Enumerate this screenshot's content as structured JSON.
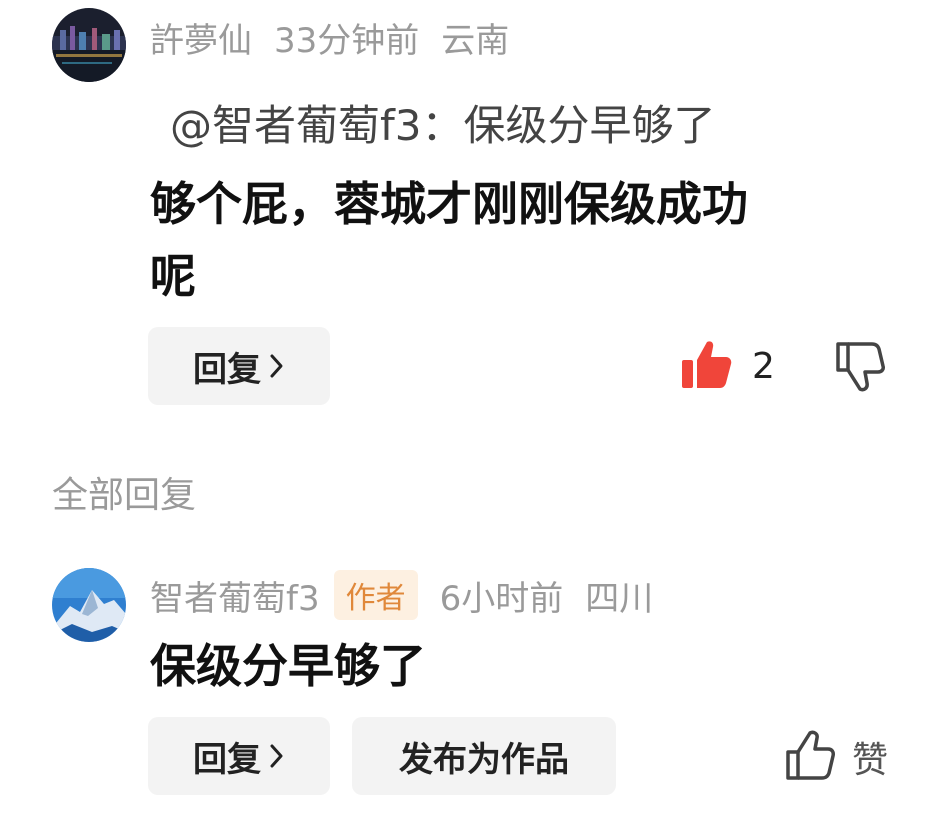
{
  "comment": {
    "username": "許夢仙",
    "time": "33分钟前",
    "location": "云南",
    "quote": "@智者葡萄f3：保级分早够了",
    "text_line1": "够个屁，蓉城才刚刚保级成功",
    "text_line2": "呢",
    "reply_label": "回复",
    "like_count": "2",
    "like_state": "liked",
    "accent_color": "#f0453a"
  },
  "replies_section": {
    "title": "全部回复"
  },
  "reply": {
    "username": "智者葡萄f3",
    "badge": "作者",
    "time": "6小时前",
    "location": "四川",
    "text": "保级分早够了",
    "reply_label": "回复",
    "publish_label": "发布为作品",
    "like_label": "赞"
  },
  "icons": {
    "thumbs_up_filled": "thumbs-up-filled-icon",
    "thumbs_down": "thumbs-down-icon",
    "thumbs_up_outline": "thumbs-up-icon",
    "chevron": "chevron-right-icon"
  }
}
